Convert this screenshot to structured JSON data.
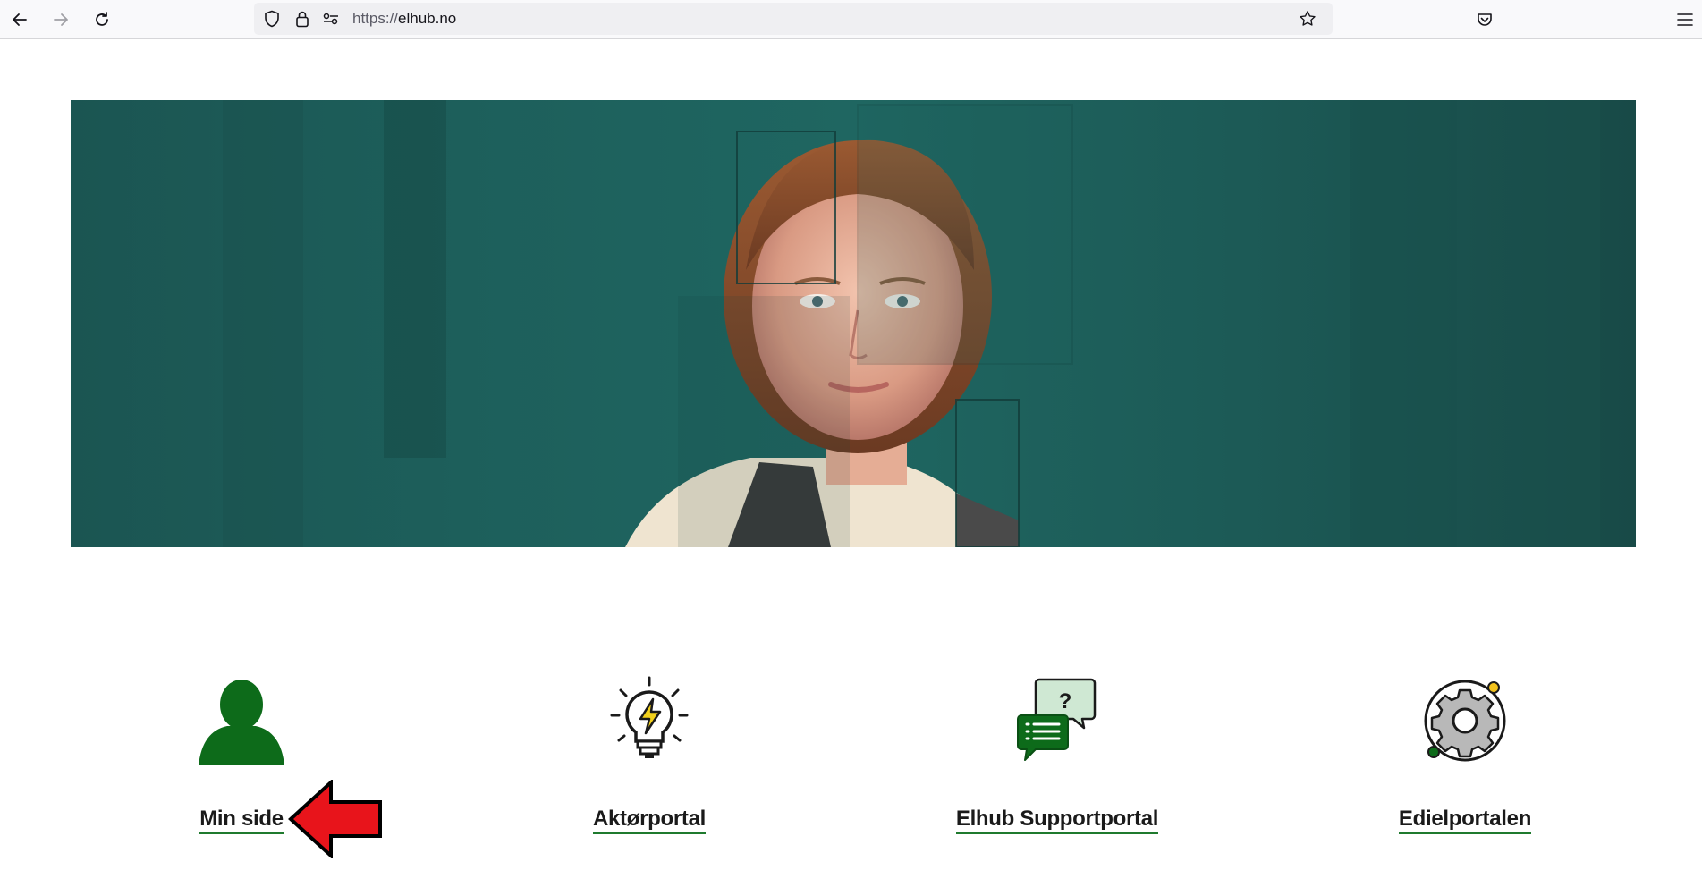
{
  "browser": {
    "url_protocol": "https://",
    "url_host": "elhub.no",
    "icons": {
      "back": "arrow-left-icon",
      "forward": "arrow-right-icon",
      "reload": "reload-icon",
      "tracking": "shield-icon",
      "lock": "lock-icon",
      "permissions": "permissions-icon",
      "bookmark": "star-icon",
      "pocket": "pocket-icon",
      "menu": "hamburger-menu-icon"
    }
  },
  "hero": {
    "image": "portrait-collage-image",
    "background_color": "#1d5f5b"
  },
  "portals": [
    {
      "label": "Min side",
      "icon": "person-icon"
    },
    {
      "label": "Aktørportal",
      "icon": "lightbulb-bolt-icon"
    },
    {
      "label": "Elhub Supportportal",
      "icon": "chat-question-icon"
    },
    {
      "label": "Edielportalen",
      "icon": "gear-icon"
    }
  ],
  "annotation": {
    "icon": "red-arrow-icon",
    "color": "#e8141b"
  },
  "colors": {
    "accent_green": "#1f7a2e",
    "icon_green": "#0d6b1a"
  }
}
